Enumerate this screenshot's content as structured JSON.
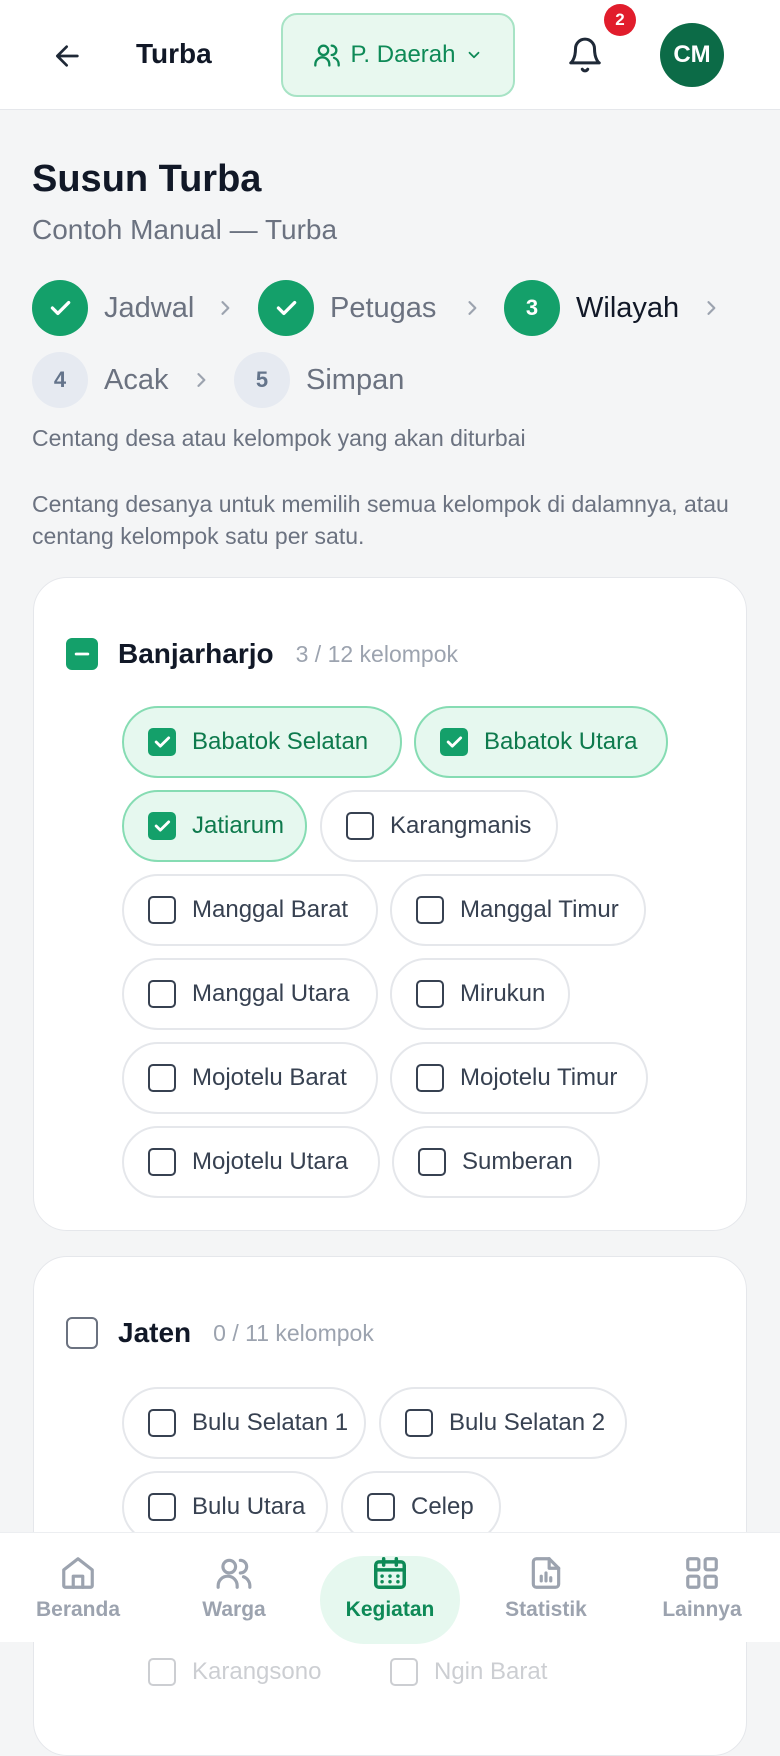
{
  "header": {
    "title": "Turba",
    "role": "P. Daerah",
    "notification_count": "2",
    "avatar_initials": "CM",
    "icons": {
      "back": "arrow-left-icon",
      "role": "users-icon",
      "dropdown": "chevron-down-icon",
      "bell": "bell-icon"
    }
  },
  "page": {
    "title": "Susun Turba",
    "subtitle": "Contoh Manual — Turba"
  },
  "steps": [
    {
      "label": "Jadwal",
      "number": "1",
      "state": "done"
    },
    {
      "label": "Petugas",
      "number": "2",
      "state": "done"
    },
    {
      "label": "Wilayah",
      "number": "3",
      "state": "active"
    },
    {
      "label": "Acak",
      "number": "4",
      "state": "todo"
    },
    {
      "label": "Simpan",
      "number": "5",
      "state": "todo"
    }
  ],
  "instructions": {
    "line1": "Centang desa atau kelompok yang akan diturbai",
    "line2": "Centang desanya untuk memilih semua kelompok di dalamnya, atau centang kelompok satu per satu."
  },
  "villages": [
    {
      "name": "Banjarharjo",
      "count": "3 / 12 kelompok",
      "state": "partial",
      "groups": [
        {
          "label": "Babatok Selatan",
          "checked": true
        },
        {
          "label": "Babatok Utara",
          "checked": true
        },
        {
          "label": "Jatiarum",
          "checked": true
        },
        {
          "label": "Karangmanis",
          "checked": false
        },
        {
          "label": "Manggal Barat",
          "checked": false
        },
        {
          "label": "Manggal Timur",
          "checked": false
        },
        {
          "label": "Manggal Utara",
          "checked": false
        },
        {
          "label": "Mirukun",
          "checked": false
        },
        {
          "label": "Mojotelu Barat",
          "checked": false
        },
        {
          "label": "Mojotelu Timur",
          "checked": false
        },
        {
          "label": "Mojotelu Utara",
          "checked": false
        },
        {
          "label": "Sumberan",
          "checked": false
        }
      ]
    },
    {
      "name": "Jaten",
      "count": "0 / 11 kelompok",
      "state": "empty",
      "groups": [
        {
          "label": "Bulu Selatan 1",
          "checked": false
        },
        {
          "label": "Bulu Selatan 2",
          "checked": false
        },
        {
          "label": "Bulu Utara",
          "checked": false
        },
        {
          "label": "Celep",
          "checked": false
        },
        {
          "label": "Karangsono",
          "checked": false
        },
        {
          "label": "Ngin Barat",
          "checked": false
        }
      ]
    }
  ],
  "nav": [
    {
      "label": "Beranda",
      "icon": "home-icon",
      "active": false
    },
    {
      "label": "Warga",
      "icon": "users-icon",
      "active": false
    },
    {
      "label": "Kegiatan",
      "icon": "calendar-icon",
      "active": true
    },
    {
      "label": "Statistik",
      "icon": "report-chart-icon",
      "active": false
    },
    {
      "label": "Lainnya",
      "icon": "grid-icon",
      "active": false
    }
  ],
  "colors": {
    "accent": "#14a06a",
    "accent_dark": "#0c6b47",
    "badge": "#e11d2c",
    "chip_selected_bg": "#e6f8ef"
  }
}
